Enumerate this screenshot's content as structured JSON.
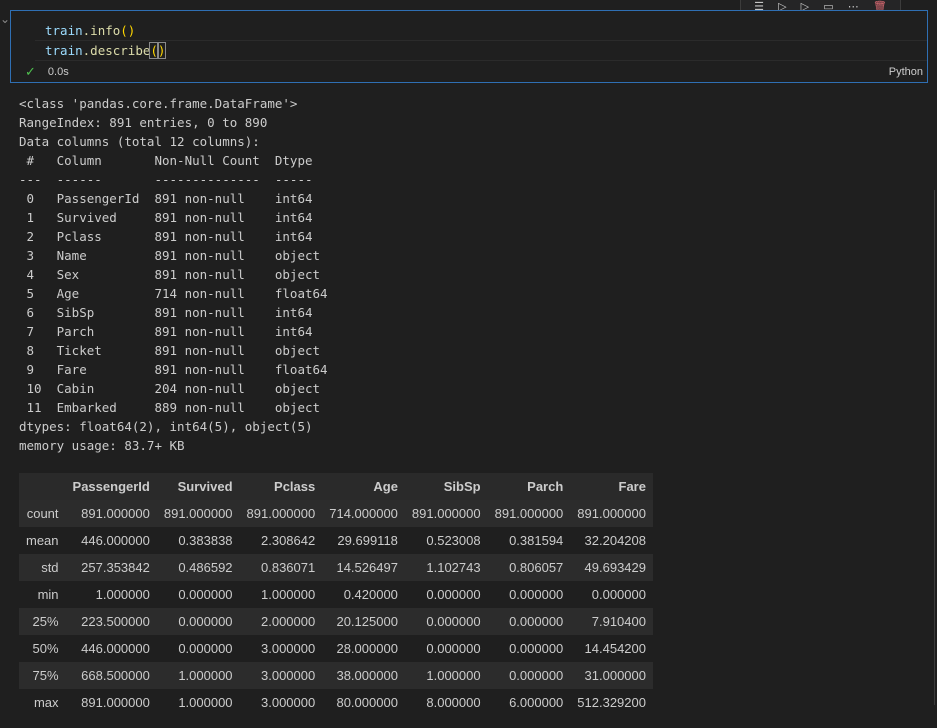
{
  "toolbar": {
    "icons": [
      "run-by-line-icon",
      "execute-above-icon",
      "execute-below-icon",
      "split-cell-icon",
      "more-icon",
      "delete-icon"
    ]
  },
  "cell": {
    "code_line1_obj": "train",
    "code_line1_fn": ".info",
    "code_line1_parens": "()",
    "code_line2_obj": "train",
    "code_line2_fn": ".describe",
    "code_line2_open": "(",
    "code_line2_close": ")",
    "status_time": "0.0s",
    "language": "Python"
  },
  "output_text": "<class 'pandas.core.frame.DataFrame'>\nRangeIndex: 891 entries, 0 to 890\nData columns (total 12 columns):\n #   Column       Non-Null Count  Dtype  \n---  ------       --------------  -----  \n 0   PassengerId  891 non-null    int64  \n 1   Survived     891 non-null    int64  \n 2   Pclass       891 non-null    int64  \n 3   Name         891 non-null    object \n 4   Sex          891 non-null    object \n 5   Age          714 non-null    float64\n 6   SibSp        891 non-null    int64  \n 7   Parch        891 non-null    int64  \n 8   Ticket       891 non-null    object \n 9   Fare         891 non-null    float64\n 10  Cabin        204 non-null    object \n 11  Embarked     889 non-null    object \ndtypes: float64(2), int64(5), object(5)\nmemory usage: 83.7+ KB",
  "describe_table": {
    "columns": [
      "",
      "PassengerId",
      "Survived",
      "Pclass",
      "Age",
      "SibSp",
      "Parch",
      "Fare"
    ],
    "rows": [
      [
        "count",
        "891.000000",
        "891.000000",
        "891.000000",
        "714.000000",
        "891.000000",
        "891.000000",
        "891.000000"
      ],
      [
        "mean",
        "446.000000",
        "0.383838",
        "2.308642",
        "29.699118",
        "0.523008",
        "0.381594",
        "32.204208"
      ],
      [
        "std",
        "257.353842",
        "0.486592",
        "0.836071",
        "14.526497",
        "1.102743",
        "0.806057",
        "49.693429"
      ],
      [
        "min",
        "1.000000",
        "0.000000",
        "1.000000",
        "0.420000",
        "0.000000",
        "0.000000",
        "0.000000"
      ],
      [
        "25%",
        "223.500000",
        "0.000000",
        "2.000000",
        "20.125000",
        "0.000000",
        "0.000000",
        "7.910400"
      ],
      [
        "50%",
        "446.000000",
        "0.000000",
        "3.000000",
        "28.000000",
        "0.000000",
        "0.000000",
        "14.454200"
      ],
      [
        "75%",
        "668.500000",
        "1.000000",
        "3.000000",
        "38.000000",
        "1.000000",
        "0.000000",
        "31.000000"
      ],
      [
        "max",
        "891.000000",
        "1.000000",
        "3.000000",
        "80.000000",
        "8.000000",
        "6.000000",
        "512.329200"
      ]
    ]
  }
}
